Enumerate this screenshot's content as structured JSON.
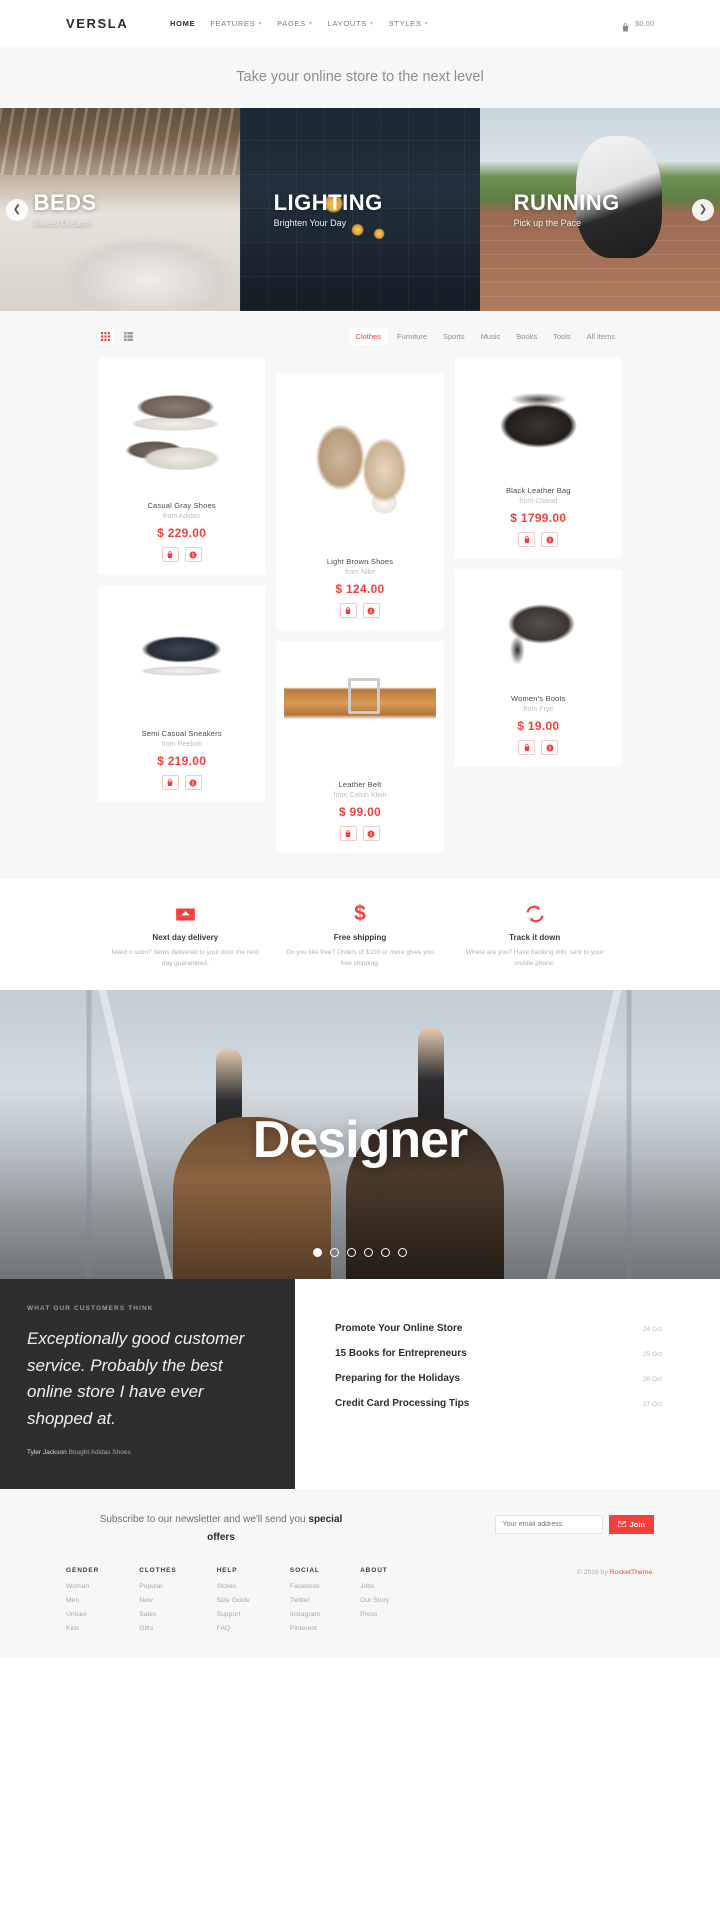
{
  "header": {
    "brand": "VERSLA",
    "nav": [
      {
        "label": "HOME",
        "caret": false,
        "active": true
      },
      {
        "label": "FEATURES",
        "caret": true,
        "active": false
      },
      {
        "label": "PAGES",
        "caret": true,
        "active": false
      },
      {
        "label": "LAYOUTS",
        "caret": true,
        "active": false
      },
      {
        "label": "STYLES",
        "caret": true,
        "active": false
      }
    ],
    "cart_amount": "$0.00",
    "cart_icon": "shopping-bag-icon"
  },
  "tagline": "Take your online store to the next level",
  "slider": {
    "prev_icon": "chevron-left-icon",
    "next_icon": "chevron-right-icon",
    "slides": [
      {
        "title": "BEDS",
        "subtitle": "Sweet Dreams"
      },
      {
        "title": "LIGHTING",
        "subtitle": "Brighten Your Day"
      },
      {
        "title": "RUNNING",
        "subtitle": "Pick up the Pace"
      }
    ]
  },
  "products": {
    "views": [
      {
        "icon": "grid-view-icon",
        "active": true
      },
      {
        "icon": "list-view-icon",
        "active": false
      }
    ],
    "categories": [
      {
        "label": "Clothes",
        "active": true
      },
      {
        "label": "Furniture",
        "active": false
      },
      {
        "label": "Sports",
        "active": false
      },
      {
        "label": "Music",
        "active": false
      },
      {
        "label": "Books",
        "active": false
      },
      {
        "label": "Tools",
        "active": false
      },
      {
        "label": "All items",
        "active": false
      }
    ],
    "items": [
      {
        "name": "Casual Gray Shoes",
        "brand": "from Adidas",
        "price": "$ 229.00",
        "thumb": "shoe-a"
      },
      {
        "name": "Semi Casual Sneakers",
        "brand": "from Reebok",
        "price": "$ 219.00",
        "thumb": "shoe-c"
      },
      {
        "name": "Light Brown Shoes",
        "brand": "from Nike",
        "price": "$ 124.00",
        "thumb": "shoe-b"
      },
      {
        "name": "Leather Belt",
        "brand": "from Calvin Klein",
        "price": "$ 99.00",
        "thumb": "belt-a"
      },
      {
        "name": "Black Leather Bag",
        "brand": "from Chanel",
        "price": "$ 1799.00",
        "thumb": "bag-a"
      },
      {
        "name": "Women's Boots",
        "brand": "from Frye",
        "price": "$ 19.00",
        "thumb": "boot-a"
      }
    ],
    "action_icons": {
      "cart": "add-to-cart-icon",
      "info": "product-info-icon"
    }
  },
  "services": [
    {
      "icon": "delivery-box-icon",
      "title": "Next day delivery",
      "text": "Need it soon? Items delivered to your door the next day guaranteed."
    },
    {
      "icon": "dollar-sign-icon",
      "title": "Free shipping",
      "text": "Do you like free? Orders of $100 or more gives you free shipping."
    },
    {
      "icon": "refresh-track-icon",
      "title": "Track it down",
      "text": "Where are you? Have tracking info, sent to your mobile phone."
    }
  ],
  "banner": {
    "title": "Designer",
    "dots": [
      true,
      false,
      false,
      false,
      false,
      false
    ]
  },
  "testimonial": {
    "label": "WHAT OUR CUSTOMERS THINK",
    "quote": "Exceptionally good customer service. Probably the best online store I have ever shopped at.",
    "author": "Tyler Jackson",
    "purchase": "Bought Adidas Shoes"
  },
  "blog": [
    {
      "title": "Promote Your Online Store",
      "date": "24 Oct"
    },
    {
      "title": "15 Books for Entrepreneurs",
      "date": "25 Oct"
    },
    {
      "title": "Preparing for the Holidays",
      "date": "26 Oct"
    },
    {
      "title": "Credit Card Processing Tips",
      "date": "27 Oct"
    }
  ],
  "newsletter": {
    "text_start": "Subscribe to our newsletter and we'll send you ",
    "text_bold": "special offers",
    "placeholder": "Your email address",
    "value": "",
    "button": "Join",
    "button_icon": "envelope-icon"
  },
  "footer": {
    "columns": [
      {
        "heading": "GENDER",
        "links": [
          "Woman",
          "Men",
          "Unisex",
          "Kids"
        ]
      },
      {
        "heading": "CLOTHES",
        "links": [
          "Popular",
          "New",
          "Sales",
          "Gifts"
        ]
      },
      {
        "heading": "HELP",
        "links": [
          "Stores",
          "Size Guide",
          "Support",
          "FAQ"
        ]
      },
      {
        "heading": "SOCIAL",
        "links": [
          "Facebook",
          "Twitter",
          "Instagram",
          "Pinterest"
        ]
      },
      {
        "heading": "ABOUT",
        "links": [
          "Jobs",
          "Our Story",
          "Press"
        ]
      }
    ],
    "copyright_pre": "© 2016 by ",
    "copyright_brand": "RocketTheme."
  },
  "colors": {
    "accent": "#f2413c",
    "dark": "#2e2e2e",
    "muted": "#b2b2b2",
    "bg": "#f7f7f7"
  }
}
